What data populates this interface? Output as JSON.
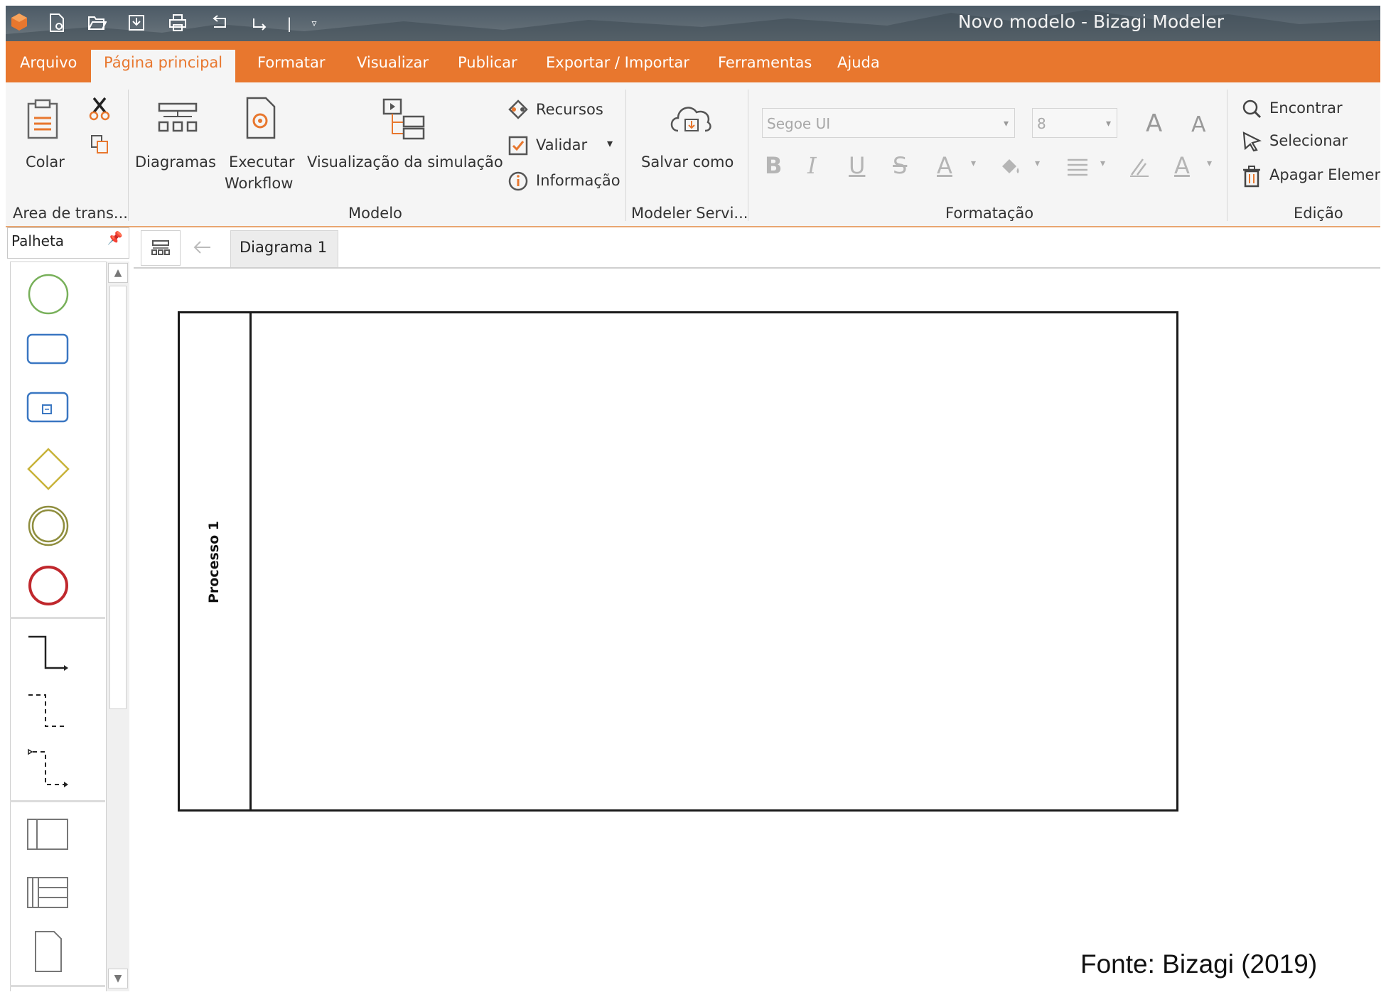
{
  "window": {
    "title": "Novo modelo - Bizagi Modeler"
  },
  "colors": {
    "accent": "#e8772e",
    "titlebar": "#5f6b74",
    "ribbon_bg": "#f5f5f5"
  },
  "quick_access": [
    "logo-icon",
    "new-document-icon",
    "open-folder-icon",
    "save-icon",
    "print-icon",
    "undo-icon",
    "redo-icon",
    "customize-icon"
  ],
  "menu": {
    "file": "Arquivo",
    "tabs": [
      {
        "label": "Página principal",
        "active": true
      },
      {
        "label": "Formatar"
      },
      {
        "label": "Visualizar"
      },
      {
        "label": "Publicar"
      },
      {
        "label": "Exportar / Importar"
      },
      {
        "label": "Ferramentas"
      },
      {
        "label": "Ajuda"
      }
    ]
  },
  "ribbon": {
    "clipboard": {
      "paste": "Colar",
      "group": "Area de trans..."
    },
    "model": {
      "diagrams": "Diagramas",
      "run_workflow_1": "Executar",
      "run_workflow_2": "Workflow",
      "simulation": "Visualização da simulação",
      "resources": "Recursos",
      "validate": "Validar",
      "information": "Informação",
      "group": "Modelo"
    },
    "services": {
      "save_as": "Salvar como",
      "group": "Modeler Servi..."
    },
    "formatting": {
      "font": "Segoe UI",
      "size": "8",
      "group": "Formatação"
    },
    "editing": {
      "find": "Encontrar",
      "select": "Selecionar",
      "delete": "Apagar Elemen",
      "group": "Edição"
    }
  },
  "palette": {
    "title": "Palheta",
    "items": [
      "start-event",
      "task",
      "subprocess",
      "gateway",
      "intermediate-event",
      "end-event",
      "sequence-flow",
      "association",
      "message-flow",
      "pool",
      "lanes",
      "data-object"
    ]
  },
  "document": {
    "tabs": [
      {
        "label": "Diagrama 1",
        "active": true
      }
    ],
    "pool_label": "Processo 1"
  },
  "caption": "Fonte: Bizagi (2019)"
}
